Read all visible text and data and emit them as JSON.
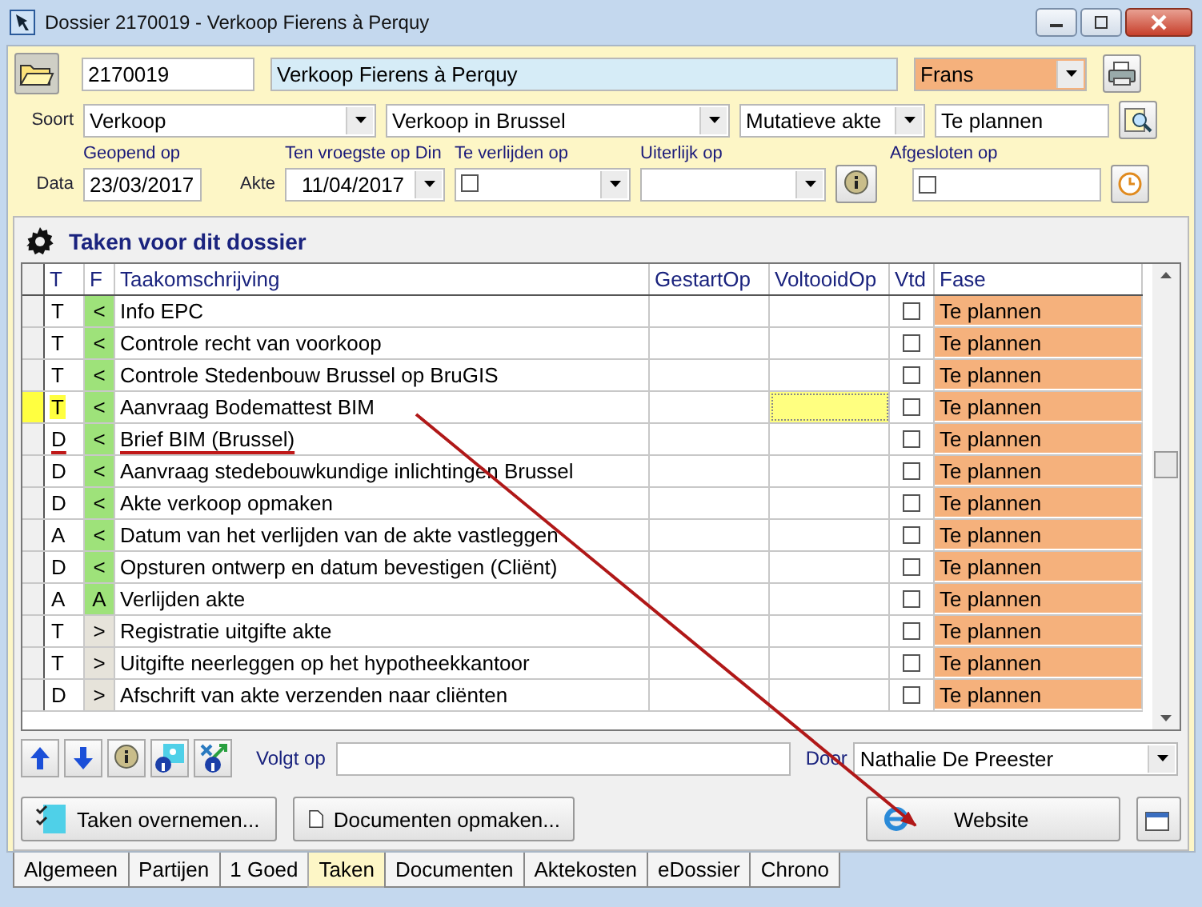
{
  "window": {
    "title": "Dossier 2170019 - Verkoop Fierens à Perquy"
  },
  "header": {
    "number": "2170019",
    "name": "Verkoop Fierens à Perquy",
    "language": "Frans"
  },
  "soort": {
    "label": "Soort",
    "type": "Verkoop",
    "subtype": "Verkoop in Brussel",
    "akte_type": "Mutatieve akte",
    "status": "Te plannen"
  },
  "dates": {
    "data_label": "Data",
    "geopend_label": "Geopend op",
    "geopend": "23/03/2017",
    "akte_label": "Akte",
    "vroegste_label": "Ten vroegste op Din",
    "vroegste": "11/04/2017",
    "verlijden_label": "Te verlijden op",
    "verlijden_checked": false,
    "uiterlijk_label": "Uiterlijk op",
    "afgesloten_label": "Afgesloten op",
    "afgesloten_checked": false
  },
  "tasks": {
    "title": "Taken voor dit dossier",
    "columns": [
      "T",
      "F",
      "Taakomschrijving",
      "GestartOp",
      "VoltooidOp",
      "Vtd",
      "Fase"
    ],
    "rows": [
      {
        "t": "T",
        "f": "<",
        "color": "#9ee27a",
        "description": "Info EPC",
        "done": false,
        "phase": "Te plannen",
        "selected": false,
        "annotated": false
      },
      {
        "t": "T",
        "f": "<",
        "color": "#9ee27a",
        "description": "Controle recht van voorkoop",
        "done": false,
        "phase": "Te plannen",
        "selected": false,
        "annotated": false
      },
      {
        "t": "T",
        "f": "<",
        "color": "#9ee27a",
        "description": "Controle Stedenbouw Brussel op BruGIS",
        "done": false,
        "phase": "Te plannen",
        "selected": false,
        "annotated": false
      },
      {
        "t": "T",
        "f": "<",
        "color": "#9ee27a",
        "description": "Aanvraag Bodemattest BIM",
        "done": false,
        "phase": "Te plannen",
        "selected": true,
        "annotated": false
      },
      {
        "t": "D",
        "f": "<",
        "color": "#9ee27a",
        "description": "Brief BIM (Brussel)",
        "done": false,
        "phase": "Te plannen",
        "selected": false,
        "annotated": true
      },
      {
        "t": "D",
        "f": "<",
        "color": "#9ee27a",
        "description": "Aanvraag stedebouwkundige inlichtingen Brussel",
        "done": false,
        "phase": "Te plannen",
        "selected": false,
        "annotated": false
      },
      {
        "t": "D",
        "f": "<",
        "color": "#9ee27a",
        "description": "Akte verkoop opmaken",
        "done": false,
        "phase": "Te plannen",
        "selected": false,
        "annotated": false
      },
      {
        "t": "A",
        "f": "<",
        "color": "#9ee27a",
        "description": "Datum van het verlijden van de akte vastleggen",
        "done": false,
        "phase": "Te plannen",
        "selected": false,
        "annotated": false
      },
      {
        "t": "D",
        "f": "<",
        "color": "#9ee27a",
        "description": "Opsturen ontwerp en datum bevestigen (Cliënt)",
        "done": false,
        "phase": "Te plannen",
        "selected": false,
        "annotated": false
      },
      {
        "t": "A",
        "f": "A",
        "color": "#9ee27a",
        "description": "Verlijden akte",
        "done": false,
        "phase": "Te plannen",
        "selected": false,
        "annotated": false
      },
      {
        "t": "T",
        "f": ">",
        "color": "#e6e3da",
        "description": "Registratie uitgifte akte",
        "done": false,
        "phase": "Te plannen",
        "selected": false,
        "annotated": false
      },
      {
        "t": "T",
        "f": ">",
        "color": "#e6e3da",
        "description": "Uitgifte neerleggen op het hypotheekkantoor",
        "done": false,
        "phase": "Te plannen",
        "selected": false,
        "annotated": false
      },
      {
        "t": "D",
        "f": ">",
        "color": "#e6e3da",
        "description": "Afschrift van akte verzenden naar cliënten",
        "done": false,
        "phase": "Te plannen",
        "selected": false,
        "annotated": false
      }
    ]
  },
  "footer": {
    "volgt_label": "Volgt op",
    "door_label": "Door",
    "door": "Nathalie De Preester"
  },
  "buttons": [
    "Taken overnemen...",
    "Documenten opmaken...",
    "Website"
  ],
  "tabs": [
    {
      "label": "Algemeen",
      "selected": false
    },
    {
      "label": "Partijen",
      "selected": false
    },
    {
      "label": "1 Goed",
      "selected": false
    },
    {
      "label": "Taken",
      "selected": true
    },
    {
      "label": "Documenten",
      "selected": false
    },
    {
      "label": "Aktekosten",
      "selected": false
    },
    {
      "label": "eDossier",
      "selected": false
    },
    {
      "label": "Chrono",
      "selected": false
    }
  ]
}
